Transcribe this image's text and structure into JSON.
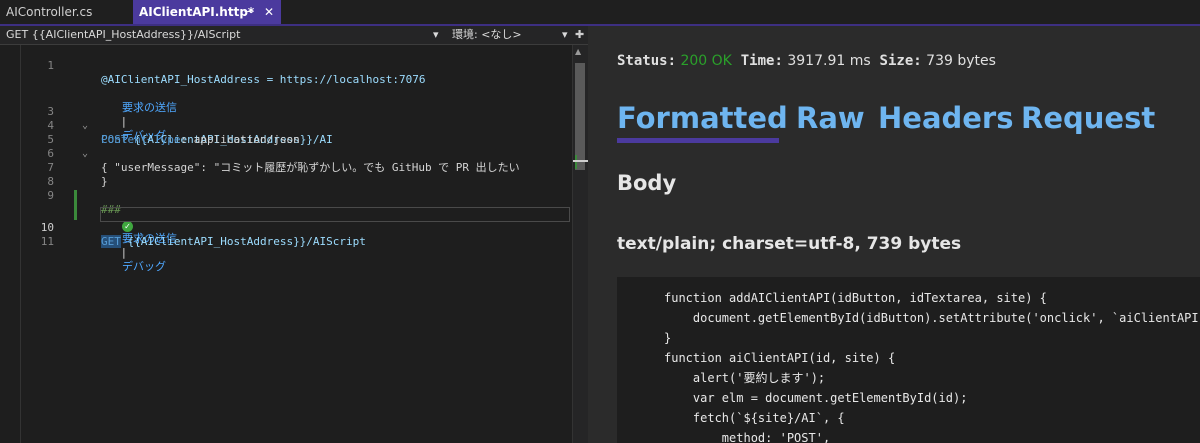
{
  "tabs": [
    {
      "label": "AIController.cs"
    },
    {
      "label": "AIClientAPI.http*",
      "pin": "⊸",
      "close": "✕"
    }
  ],
  "navbar": {
    "request": "GET {{AIClientAPI_HostAddress}}/AIScript",
    "environment": "環境: <なし>"
  },
  "editor": {
    "lines": [
      {
        "num": "1",
        "code": "@AIClientAPI_HostAddress = https://localhost:7076"
      },
      {
        "num": "",
        "codelens_send": "要求の送信",
        "codelens_sep": "|",
        "codelens_debug": "デバッグ"
      },
      {
        "num": "3",
        "method": "POST",
        "url": "{{AIClientAPI_HostAddress}}/AI"
      },
      {
        "num": "4",
        "header_name": "Content-Type",
        "header_value": ": application/json"
      },
      {
        "num": "5",
        "code": "{"
      },
      {
        "num": "6",
        "code": "  \"userMessage\": \"コミット履歴が恥ずかしい。でも GitHub で PR 出したい"
      },
      {
        "num": "7",
        "code": "}"
      },
      {
        "num": "8",
        "code": ""
      },
      {
        "num": "9",
        "code": "###"
      },
      {
        "num": "",
        "codelens_send": "要求の送信",
        "codelens_sep": "|",
        "codelens_debug": "デバッグ"
      },
      {
        "num": "10",
        "method": "GET",
        "url": "{{AIClientAPI_HostAddress}}/AIScript"
      },
      {
        "num": "11",
        "code": ""
      }
    ]
  },
  "response": {
    "status_label": "Status:",
    "status_value": "200 OK",
    "time_label": "Time:",
    "time_value": "3917.91 ms",
    "size_label": "Size:",
    "size_value": "739 bytes",
    "tabs": [
      "Formatted",
      "Raw",
      "Headers",
      "Request"
    ],
    "body_heading": "Body",
    "content_type": "text/plain; charset=utf-8, 739 bytes",
    "code": [
      "function addAIClientAPI(idButton, idTextarea, site) {",
      "    document.getElementById(idButton).setAttribute('onclick', `aiClientAPI('${idTextarea}', '${site}')`);",
      "}",
      "function aiClientAPI(id, site) {",
      "    alert('要約します');",
      "    var elm = document.getElementById(id);",
      "    fetch(`${site}/AI`, {",
      "        method: 'POST',"
    ]
  },
  "colors": {
    "accent": "#4b3a9e",
    "status_ok": "#2aa02a",
    "tab_link": "#6eb5f0"
  }
}
